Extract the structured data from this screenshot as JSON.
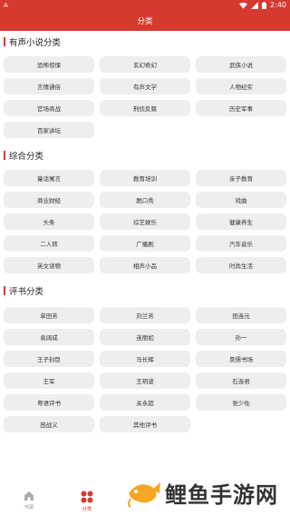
{
  "status_bar": {
    "left_icon": "A",
    "time": "2:40"
  },
  "app_bar": {
    "title": "分类"
  },
  "sections": [
    {
      "title": "有声小说分类",
      "items": [
        "恐怖惊悚",
        "玄幻奇幻",
        "武侠小说",
        "言情通俗",
        "有声文学",
        "人物纪实",
        "官场商战",
        "刑侦反腐",
        "历史军事",
        "百家讲坛"
      ]
    },
    {
      "title": "综合分类",
      "items": [
        "童话寓言",
        "教育培训",
        "亲子教育",
        "商业财经",
        "脱口秀",
        "戏曲",
        "头条",
        "综艺娱乐",
        "健康养生",
        "二人转",
        "广播剧",
        "汽车音乐",
        "英文读物",
        "相声小品",
        "时尚生活"
      ]
    },
    {
      "title": "评书分类",
      "items": [
        "单田芳",
        "刘兰芳",
        "田连元",
        "袁阔成",
        "连丽如",
        "孙一",
        "王子封臣",
        "马长辉",
        "昊儒书场",
        "王军",
        "王玥波",
        "石连君",
        "粤语评书",
        "关永超",
        "张少佐",
        "田战义",
        "其他评书"
      ]
    }
  ],
  "bottom_nav": [
    {
      "label": "书架",
      "icon": "home-icon",
      "active": false
    },
    {
      "label": "分类",
      "icon": "category-grid-icon",
      "active": true
    }
  ],
  "watermark": {
    "text": "鲤鱼手游网"
  },
  "colors": {
    "accent": "#d63a2f",
    "chip_bg": "#eeeeee",
    "inactive": "#999999"
  }
}
